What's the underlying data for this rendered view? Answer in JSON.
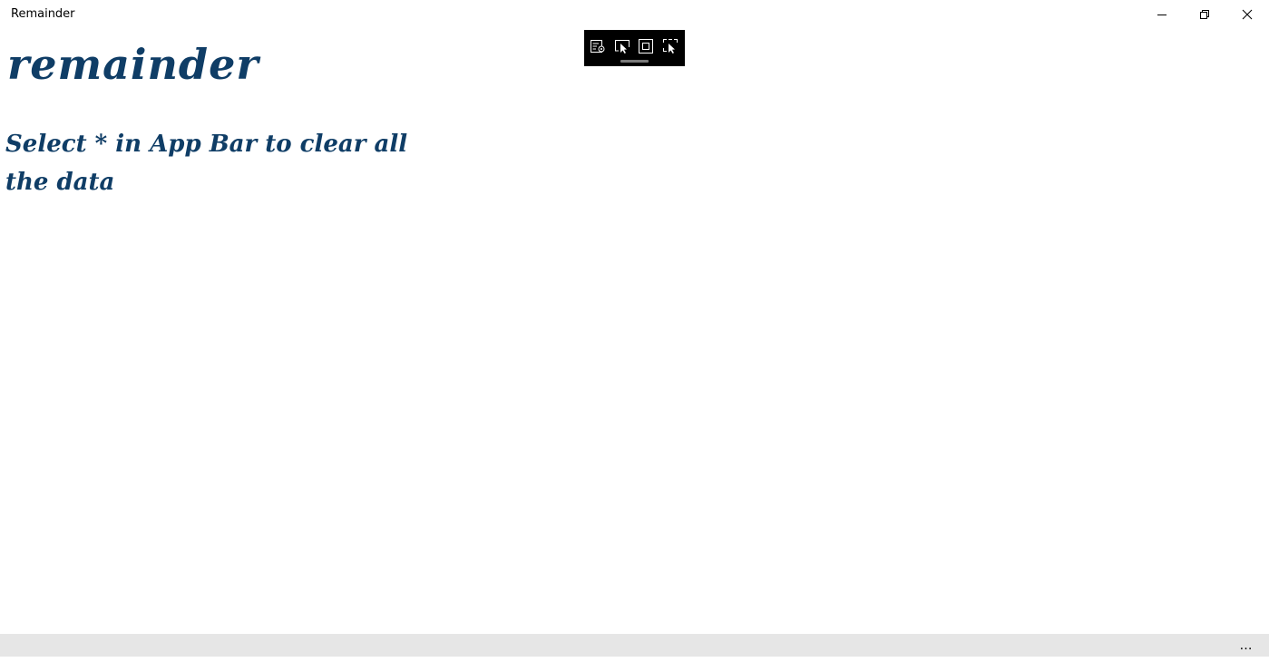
{
  "window": {
    "title": "Remainder"
  },
  "content": {
    "app_title": "remainder",
    "instruction": "Select * in App Bar to clear all the data"
  },
  "app_bar": {
    "more_label": "…"
  },
  "icons": {
    "minimize": "minimize-icon",
    "restore": "restore-icon",
    "close": "close-icon",
    "live_visual_tree": "live-visual-tree-icon",
    "select_element": "select-element-icon",
    "display_layout_adorners": "layout-adorners-icon",
    "track_focused_element": "track-focus-icon"
  },
  "colors": {
    "accent_text": "#0f3d66",
    "app_bar_bg": "#e6e6e6",
    "toolbar_bg": "#000000"
  }
}
